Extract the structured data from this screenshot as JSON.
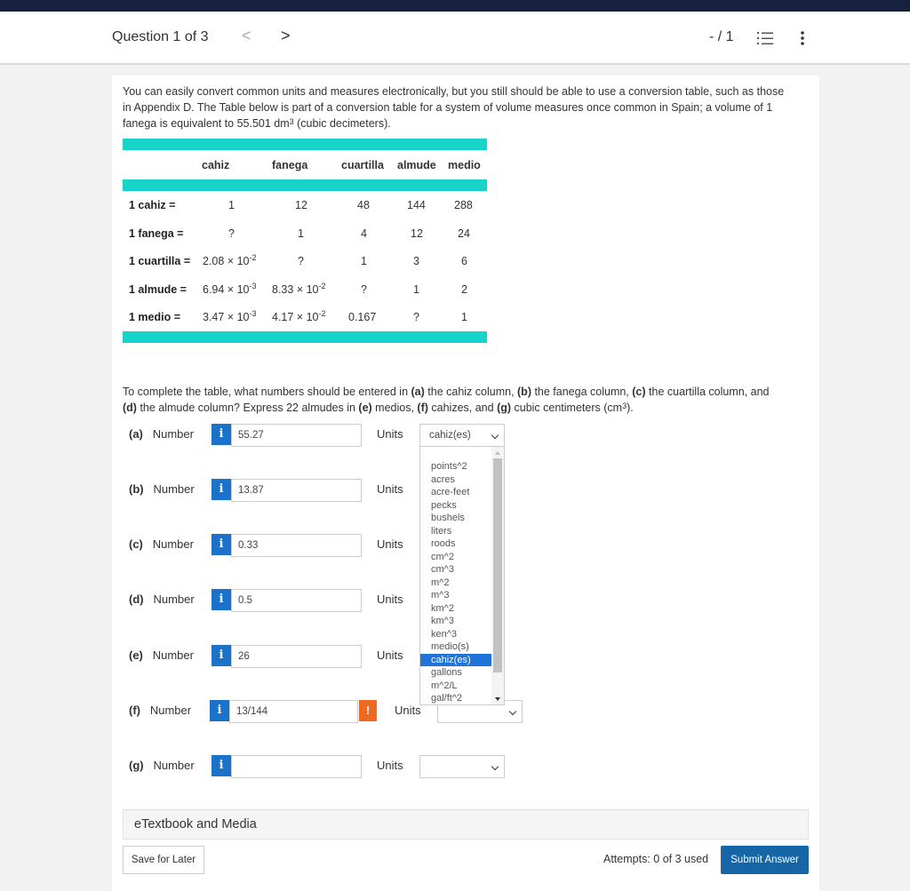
{
  "header": {
    "question_title": "Question 1 of 3",
    "prev_glyph": "<",
    "next_glyph": ">",
    "score": "- / 1"
  },
  "intro": {
    "line1": "You can easily convert common units and measures electronically, but you still should be able to use a conversion table, such as those",
    "line2": "in Appendix D. The Table below is part of a conversion table for a system of volume measures once common in Spain; a volume of 1",
    "line3_pre": "fanega is equivalent to 55.501 dm",
    "line3_sup": "3",
    "line3_post": " (cubic decimeters)."
  },
  "table": {
    "headers": [
      "cahiz",
      "fanega",
      "cuartilla",
      "almude",
      "medio"
    ],
    "rows": [
      {
        "label": "1 cahiz =",
        "c1": "1",
        "c2": "12",
        "c3": "48",
        "c4": "144",
        "c5": "288"
      },
      {
        "label": "1 fanega =",
        "c1": "?",
        "c2": "1",
        "c3": "4",
        "c4": "12",
        "c5": "24"
      },
      {
        "label": "1 cuartilla =",
        "c1_base": "2.08 × 10",
        "c1_exp": "-2",
        "c2": "?",
        "c3": "1",
        "c4": "3",
        "c5": "6"
      },
      {
        "label": "1 almude =",
        "c1_base": "6.94 × 10",
        "c1_exp": "-3",
        "c2_base": "8.33 × 10",
        "c2_exp": "-2",
        "c3": "?",
        "c4": "1",
        "c5": "2"
      },
      {
        "label": "1 medio =",
        "c1_base": "3.47 × 10",
        "c1_exp": "-3",
        "c2_base": "4.17 × 10",
        "c2_exp": "-2",
        "c3": "0.167",
        "c4": "?",
        "c5": "1"
      }
    ]
  },
  "question": {
    "l1_a": "To complete the table, what numbers should be entered in ",
    "l1_b": "(a)",
    "l1_c": " the cahiz column, ",
    "l1_d": "(b)",
    "l1_e": " the fanega column, ",
    "l1_f": "(c)",
    "l1_g": " the cuartilla column, and",
    "l2_a": "(d)",
    "l2_b": " the almude column? Express 22 almudes in ",
    "l2_c": "(e)",
    "l2_d": " medios, ",
    "l2_e": "(f)",
    "l2_f": " cahizes, and ",
    "l2_g": "(g)",
    "l2_h": " cubic centimeters (cm",
    "l2_sup": "3",
    "l2_i": ")."
  },
  "info_glyph": "i",
  "warn_glyph": "!",
  "answers": [
    {
      "part": "(a)",
      "number_label": "Number",
      "value": "55.27",
      "units_label": "Units",
      "unit": "cahiz(es)"
    },
    {
      "part": "(b)",
      "number_label": "Number",
      "value": "13.87",
      "units_label": "Units",
      "unit": ""
    },
    {
      "part": "(c)",
      "number_label": "Number",
      "value": "0.33",
      "units_label": "Units",
      "unit": ""
    },
    {
      "part": "(d)",
      "number_label": "Number",
      "value": "0.5",
      "units_label": "Units",
      "unit": ""
    },
    {
      "part": "(e)",
      "number_label": "Number",
      "value": "26",
      "units_label": "Units",
      "unit": ""
    },
    {
      "part": "(f)",
      "number_label": "Number",
      "value": "13/144",
      "units_label": "Units",
      "unit": ""
    },
    {
      "part": "(g)",
      "number_label": "Number",
      "value": "",
      "units_label": "Units",
      "unit": ""
    }
  ],
  "dropdown": {
    "options": [
      "points^2",
      "acres",
      "acre-feet",
      "pecks",
      "bushels",
      "liters",
      "roods",
      "cm^2",
      "cm^3",
      "m^2",
      "m^3",
      "km^2",
      "km^3",
      "ken^3",
      "medio(s)",
      "cahiz(es)",
      "gallons",
      "m^2/L",
      "gal/ft^2"
    ],
    "selected": "cahiz(es)"
  },
  "footer": {
    "etextbook": "eTextbook and Media",
    "save": "Save for Later",
    "attempts": "Attempts: 0 of 3 used",
    "submit": "Submit Answer"
  }
}
